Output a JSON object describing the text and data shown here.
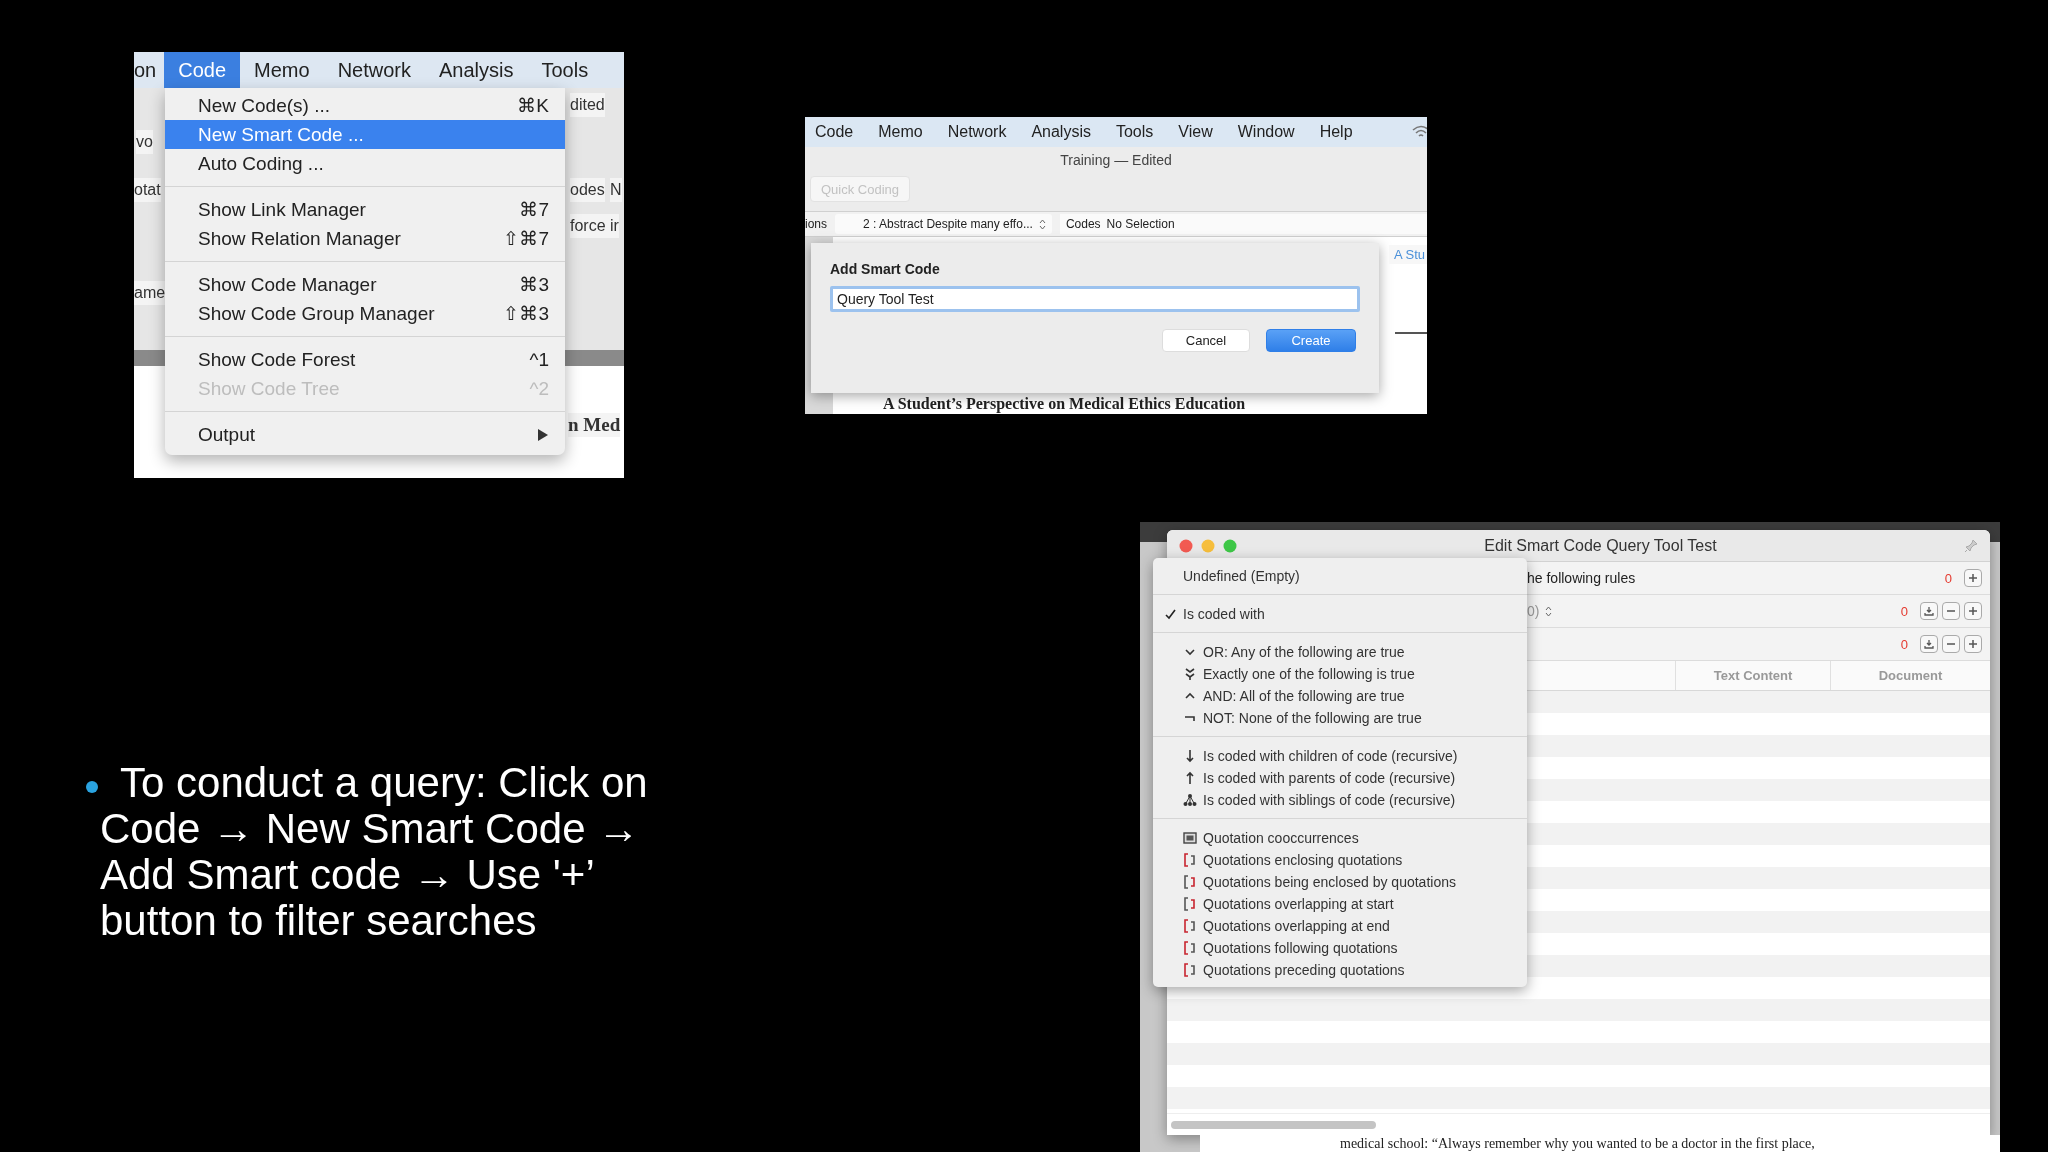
{
  "slide": {
    "bullet_lines": [
      "To conduct a query: Click on",
      "Code → New Smart Code →",
      "Add Smart code → Use '+’",
      "button to filter searches"
    ]
  },
  "code_menu_shot": {
    "menubar": [
      {
        "label": "on",
        "selected": false
      },
      {
        "label": "Code",
        "selected": true
      },
      {
        "label": "Memo",
        "selected": false
      },
      {
        "label": "Network",
        "selected": false
      },
      {
        "label": "Analysis",
        "selected": false
      },
      {
        "label": "Tools",
        "selected": false
      }
    ],
    "behind": [
      "vo",
      "otat",
      "ame",
      "dited",
      "odes",
      "N",
      "force ir",
      "n Med"
    ],
    "menu_sections": [
      [
        {
          "label": "New Code(s) ...",
          "shortcut": "⌘K",
          "selected": false,
          "disabled": false
        },
        {
          "label": "New Smart Code ...",
          "selected": true,
          "disabled": false
        },
        {
          "label": "Auto Coding ...",
          "selected": false,
          "disabled": false
        }
      ],
      [
        {
          "label": "Show Link Manager",
          "shortcut": "⌘7",
          "selected": false,
          "disabled": false
        },
        {
          "label": "Show Relation Manager",
          "shortcut": "⇧⌘7",
          "selected": false,
          "disabled": false
        }
      ],
      [
        {
          "label": "Show Code Manager",
          "shortcut": "⌘3",
          "selected": false,
          "disabled": false
        },
        {
          "label": "Show Code Group Manager",
          "shortcut": "⇧⌘3",
          "selected": false,
          "disabled": false
        }
      ],
      [
        {
          "label": "Show Code Forest",
          "shortcut": "^1",
          "selected": false,
          "disabled": false
        },
        {
          "label": "Show Code Tree",
          "shortcut": "^2",
          "selected": false,
          "disabled": true
        }
      ],
      [
        {
          "label": "Output",
          "submenu": true,
          "selected": false,
          "disabled": false
        }
      ]
    ]
  },
  "add_code_shot": {
    "menubar": [
      "Code",
      "Memo",
      "Network",
      "Analysis",
      "Tools",
      "View",
      "Window",
      "Help"
    ],
    "title": "Training — Edited",
    "quick_coding": {
      "label": "Quick Coding",
      "disabled": true
    },
    "navbar": {
      "left": "ions",
      "quotation": "2 : Abstract Despite many effo...",
      "codes_label": "Codes",
      "codes_value": "No Selection"
    },
    "side_link": "A Stu",
    "dialog": {
      "title": "Add Smart Code",
      "value": "Query Tool Test",
      "buttons": [
        {
          "label": "Cancel",
          "kind": "secondary"
        },
        {
          "label": "Create",
          "kind": "primary"
        }
      ]
    },
    "document_heading": "A Student’s Perspective on Medical Ethics Education"
  },
  "edit_shot": {
    "window_title": "Edit Smart Code Query Tool Test",
    "rules": [
      {
        "text": "he following rules",
        "count": "0",
        "buttons": [
          {
            "kind": "add"
          }
        ]
      },
      {
        "text": "0)",
        "stepper": true,
        "count": "0",
        "buttons": [
          {
            "kind": "export"
          },
          {
            "kind": "remove"
          },
          {
            "kind": "add"
          }
        ]
      },
      {
        "count": "0",
        "buttons": [
          {
            "kind": "export"
          },
          {
            "kind": "remove"
          },
          {
            "kind": "add"
          }
        ]
      }
    ],
    "columns": [
      "Text Content",
      "Document"
    ],
    "popup_sections": [
      [
        {
          "label": "Undefined (Empty)",
          "checked": false
        }
      ],
      [
        {
          "label": "Is coded with",
          "checked": true
        }
      ],
      [
        {
          "label": "OR: Any of the following are true",
          "checked": false
        },
        {
          "label": "Exactly one of the following is true",
          "checked": false
        },
        {
          "label": "AND: All of the following are true",
          "checked": false
        },
        {
          "label": "NOT: None of the following are true",
          "checked": false
        }
      ],
      [
        {
          "label": "Is coded with children of code (recursive)",
          "checked": false
        },
        {
          "label": "Is coded with parents of code (recursive)",
          "checked": false
        },
        {
          "label": "Is coded with siblings of code (recursive)",
          "checked": false
        }
      ],
      [
        {
          "label": "Quotation cooccurrences",
          "checked": false
        },
        {
          "label": "Quotations enclosing quotations",
          "checked": false
        },
        {
          "label": "Quotations being enclosed by quotations",
          "checked": false
        },
        {
          "label": "Quotations overlapping at start",
          "checked": false
        },
        {
          "label": "Quotations overlapping at end",
          "checked": false
        },
        {
          "label": "Quotations following quotations",
          "checked": false
        },
        {
          "label": "Quotations preceding quotations",
          "checked": false
        }
      ]
    ],
    "document_line": "medical school: “Always remember why you wanted to be a doctor in the first place,"
  }
}
